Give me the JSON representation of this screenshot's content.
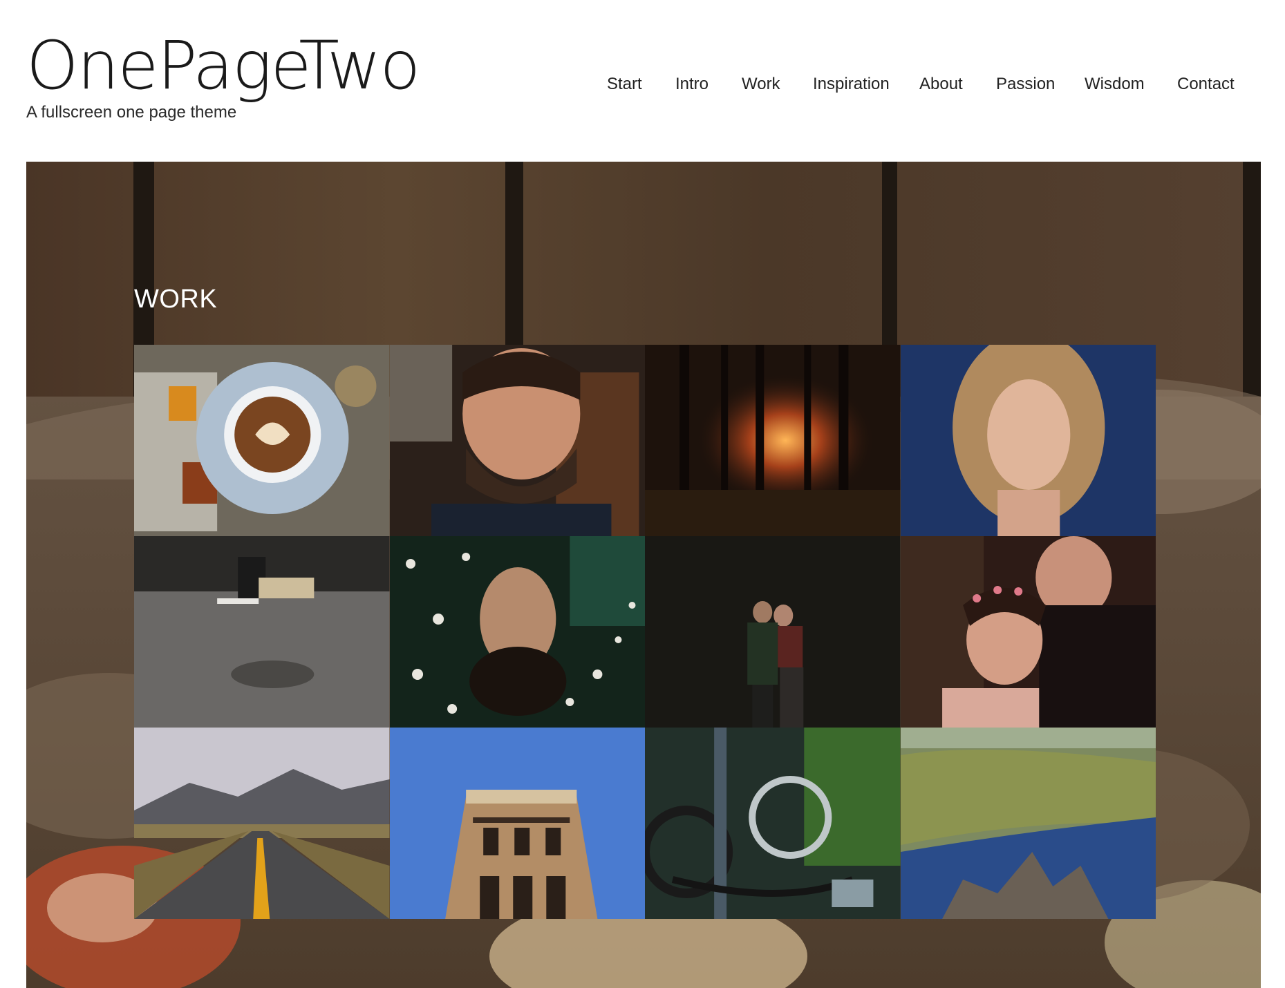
{
  "site": {
    "title": "OnePageTwo",
    "tagline": "A fullscreen one page theme"
  },
  "nav": {
    "items": [
      {
        "label": "Start"
      },
      {
        "label": "Intro"
      },
      {
        "label": "Work"
      },
      {
        "label": "Inspiration"
      },
      {
        "label": "About"
      },
      {
        "label": "Passion"
      },
      {
        "label": "Wisdom"
      },
      {
        "label": "Contact"
      }
    ]
  },
  "work": {
    "title": "WORK",
    "gallery": [
      {
        "subject": "latte art coffee cup on book",
        "dominant": "#7c7567"
      },
      {
        "subject": "bearded man portrait",
        "dominant": "#3a2a22"
      },
      {
        "subject": "sunset through forest trees",
        "dominant": "#2a1a12"
      },
      {
        "subject": "curly haired woman portrait",
        "dominant": "#1f3460"
      },
      {
        "subject": "man writing on concrete floor",
        "dominant": "#5a5a58"
      },
      {
        "subject": "woman upside down among flowers",
        "dominant": "#1a2a20"
      },
      {
        "subject": "couple in dark forest",
        "dominant": "#1b1a15"
      },
      {
        "subject": "embracing couple with flower crown",
        "dominant": "#3a2622"
      },
      {
        "subject": "desert road to mountains",
        "dominant": "#8a8a8f"
      },
      {
        "subject": "building facade against blue sky",
        "dominant": "#4a78c8"
      },
      {
        "subject": "bicycle chain and gears",
        "dominant": "#2c3a30"
      },
      {
        "subject": "green valley and lake landscape",
        "dominant": "#6a7a50"
      }
    ]
  }
}
